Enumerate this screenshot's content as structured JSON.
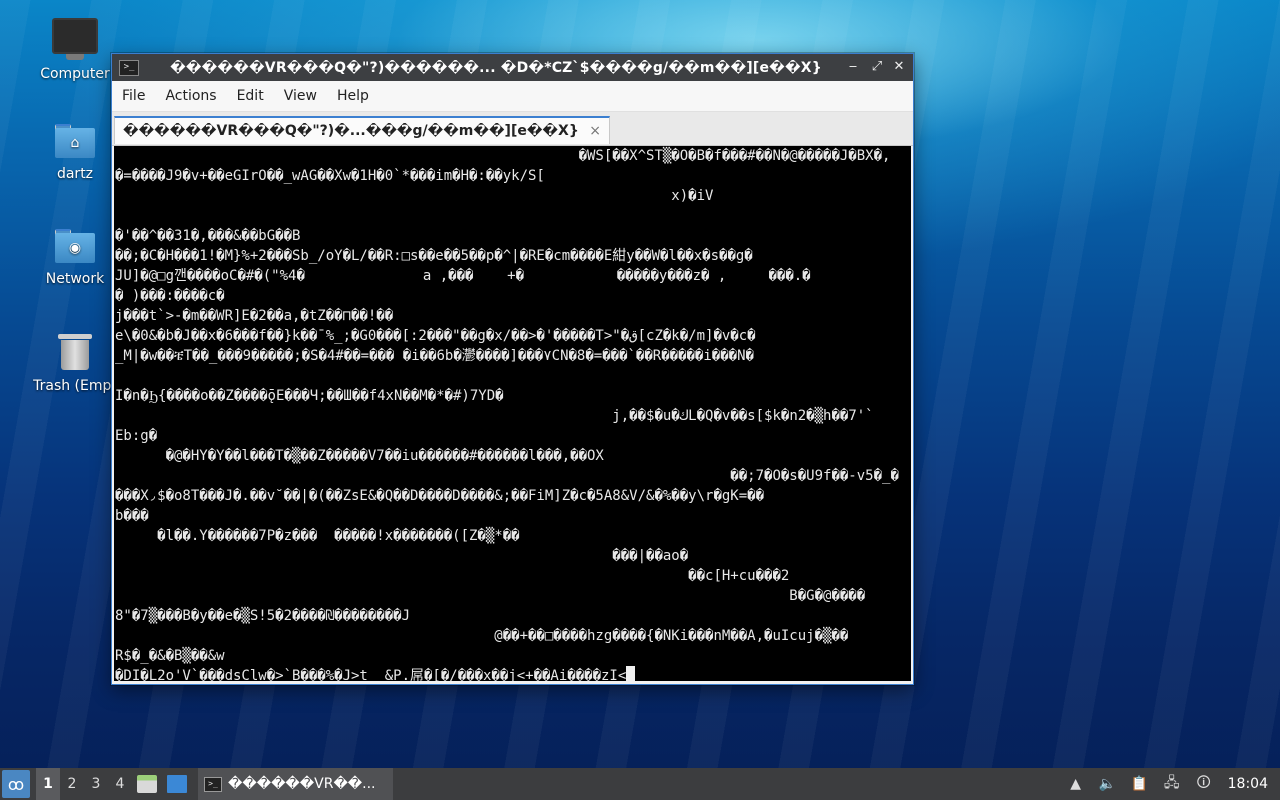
{
  "desktop": {
    "icons": [
      {
        "label": "Computer"
      },
      {
        "label": "dartz"
      },
      {
        "label": "Network"
      },
      {
        "label": "Trash (Empt"
      }
    ]
  },
  "window": {
    "title": "������VR���Q�\"?)������... �D�*CZ`$����g/��m��][e��X}",
    "controls": {
      "minimize": "‒",
      "maximize": "⤢",
      "close": "✕"
    },
    "menu": [
      "File",
      "Actions",
      "Edit",
      "View",
      "Help"
    ],
    "tab": {
      "label": "������VR���Q�\"?)�...���g/��m��][e��X}",
      "close": "×"
    }
  },
  "terminal": {
    "lines": [
      "                                                       �WS[��X^ST▒�O�B�f���#��N�@�����J�BX�,",
      "�=����J9�v+��eGIrO��_wAG��Xw�1H�0`*���im�H�:��yk/S[",
      "                                                                  x)�iV",
      "",
      "�'��^��31�,���&��bG��B",
      "��;�C�H���1!�M}%+2���Sb_/oY�L/��R:□s��e��5��p�^|�RE�cm����E紺y��W�l��x�s��g�",
      "JU]�@□g깬����oC�#�(\"%4�              a ,���    +�           �����y���z� ,     ���.�",
      "�ᡃ )���:����c�",
      "j���t`>-�m��WR]E�2��a,�tZ��⊓��!��",
      "e\\�0&�b�J��x�6���f��}k��¯%_;�G0���[:2���\"��g�x/��>�'�����T>\"�ق[cZ�k�/m]�v�c�",
      "_M|�w��ቼT��_���9�����;�S�4#��=��� �i��6b�灪����]���۷CN�8�=���`��R�����i���N�",
      "",
      "I�n�Ϧ{����o��Z����ǭE���Ч;��Ш��f4xN��M�*�#)7YD�",
      "                                                           j,��$�u�ﻙL�Q�v��s[$k�n2�▒h��7'`",
      "Eb:g�",
      "      �@�HY�Y��l���T�▒��Z�����V7��iu������#������l���,��OX",
      "                                                                         ��;7�O�s�U9f��-v5�_�",
      "���X◞$�o8T���J�.��v˘��|�(��ZsE&�Q��D����D����&;��FiM]Z�c�5A8&V/&�%��y\\r�gK=��",
      "b���",
      "     �l��.Y������7P�z���  �����!x�������([Z�▒*��",
      "                                                           ���|��ao�",
      "                                                                    ��c[H+cu���2",
      "                                                                                B�G�@����",
      "8\"�7▒���B�y��e�▒S!5�2����₪��������J",
      "                                             @��+��□����hzg����{�NKi���nM��A,�uIcuj�▒��",
      "R$�_�&�B▒��&w",
      "�DI�L2o'V`���dsClw�>`B���%�J>t__&P.屌�[�/���x��j<+��Ai����zI<"
    ]
  },
  "taskbar": {
    "workspaces": [
      "1",
      "2",
      "3",
      "4"
    ],
    "task_label": "������VR��...",
    "clock": "18:04"
  }
}
